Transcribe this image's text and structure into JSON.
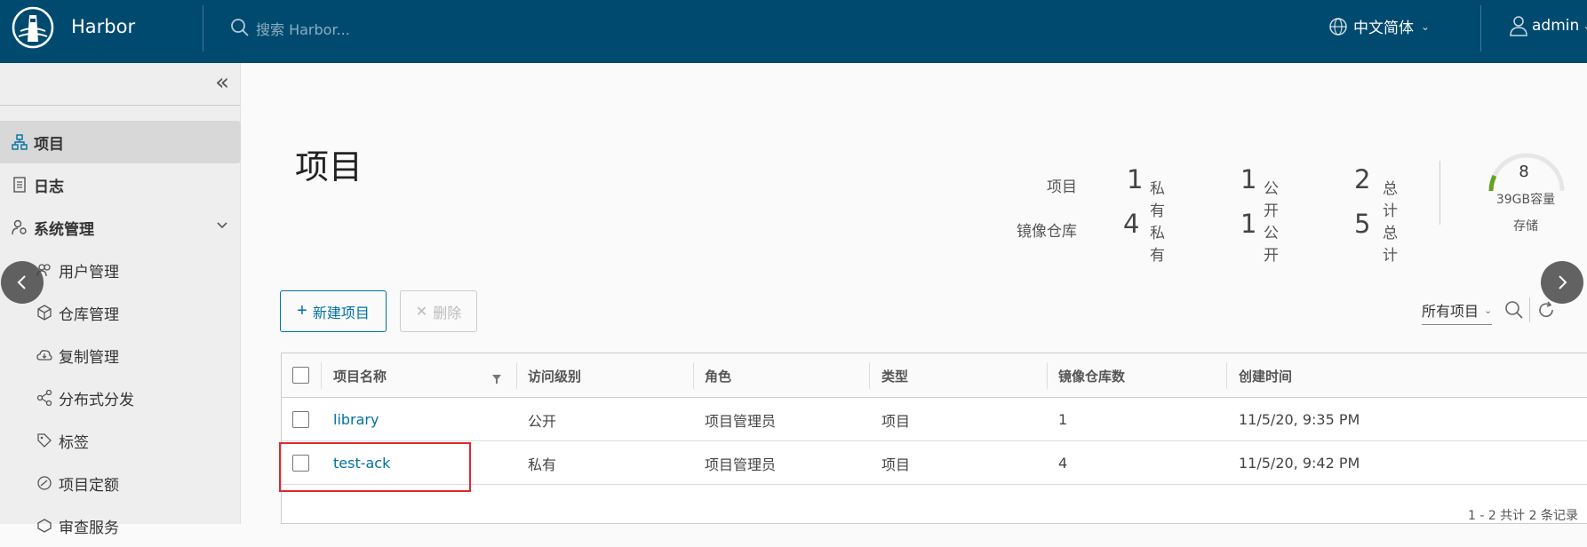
{
  "header": {
    "brand": "Harbor",
    "search_placeholder": "搜索 Harbor...",
    "language": "中文简体",
    "user": "admin"
  },
  "sidebar": {
    "items": [
      {
        "label": "项目",
        "icon": "project-icon",
        "active": true
      },
      {
        "label": "日志",
        "icon": "log-icon"
      },
      {
        "label": "系统管理",
        "icon": "admin-icon",
        "expanded": true
      },
      {
        "label": "用户管理",
        "icon": "users-icon"
      },
      {
        "label": "仓库管理",
        "icon": "registry-icon"
      },
      {
        "label": "复制管理",
        "icon": "replication-icon"
      },
      {
        "label": "分布式分发",
        "icon": "distribution-icon"
      },
      {
        "label": "标签",
        "icon": "tag-icon"
      },
      {
        "label": "项目定额",
        "icon": "quota-icon"
      },
      {
        "label": "审查服务",
        "icon": "interrogation-icon"
      }
    ]
  },
  "main": {
    "title": "项目",
    "stats": {
      "projects_label": "项目",
      "repos_label": "镜像仓库",
      "private_word": "私有",
      "public_word": "公开",
      "total_word": "总计",
      "projects": {
        "private": "1",
        "public": "1",
        "total": "2"
      },
      "repos": {
        "private": "4",
        "public": "1",
        "total": "5"
      }
    },
    "storage": {
      "number": "8",
      "capacity": "39GB容量",
      "label": "存储"
    },
    "buttons": {
      "new_project": "新建项目",
      "delete": "删除"
    },
    "filter": {
      "selected": "所有项目"
    },
    "table": {
      "headers": [
        "项目名称",
        "访问级别",
        "角色",
        "类型",
        "镜像仓库数",
        "创建时间"
      ],
      "rows": [
        {
          "name": "library",
          "access": "公开",
          "role": "项目管理员",
          "type": "项目",
          "repo_count": "1",
          "created": "11/5/20, 9:35 PM"
        },
        {
          "name": "test-ack",
          "access": "私有",
          "role": "项目管理员",
          "type": "项目",
          "repo_count": "4",
          "created": "11/5/20, 9:42 PM"
        }
      ],
      "footer": "1 - 2 共计 2 条记录"
    }
  },
  "colors": {
    "header_bg": "#004a70",
    "link": "#0072a3",
    "highlight": "#e0282e",
    "gauge": "#62a420"
  }
}
